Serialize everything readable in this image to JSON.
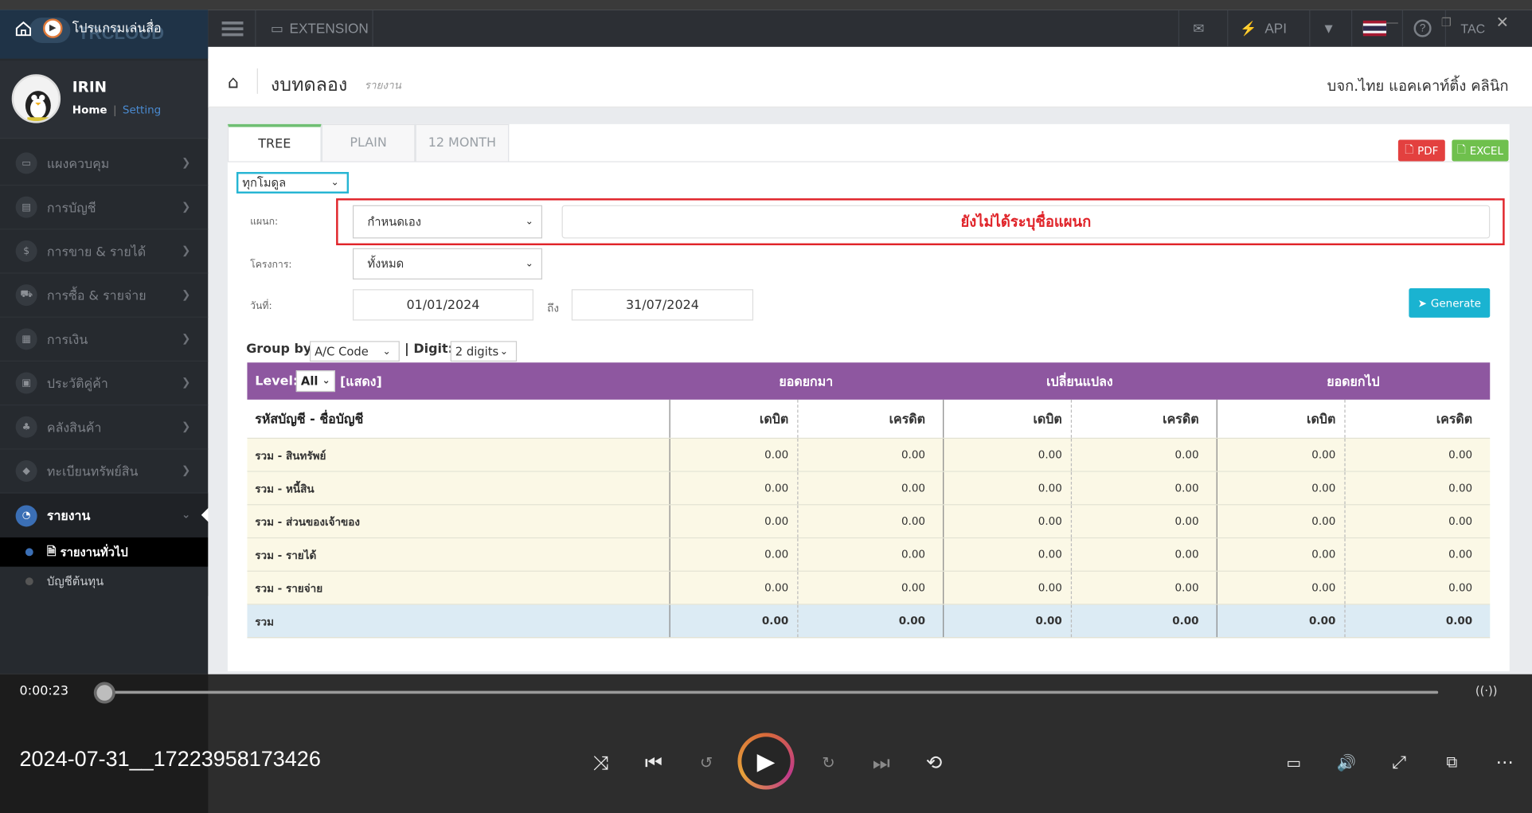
{
  "player": {
    "app_title": "โปรแกรมเล่นสื่อ",
    "time": "0:00:23",
    "filename": "2024-07-31__17223958173426"
  },
  "header": {
    "brand": "TRCLOUD",
    "extension_label": "EXTENSION",
    "api_label": "API",
    "user_code": "TAC"
  },
  "profile": {
    "name": "IRIN",
    "home_link": "Home",
    "setting_link": "Setting"
  },
  "sidebar": {
    "items": [
      {
        "label": "แผงควบคุม",
        "icon": "monitor-icon"
      },
      {
        "label": "การบัญชี",
        "icon": "book-icon"
      },
      {
        "label": "การขาย & รายได้",
        "icon": "dollar-icon"
      },
      {
        "label": "การซื้อ & รายจ่าย",
        "icon": "cart-icon"
      },
      {
        "label": "การเงิน",
        "icon": "calendar-icon"
      },
      {
        "label": "ประวัติคู่ค้า",
        "icon": "contacts-icon"
      },
      {
        "label": "คลังสินค้า",
        "icon": "boxes-icon"
      },
      {
        "label": "ทะเบียนทรัพย์สิน",
        "icon": "diamond-icon"
      },
      {
        "label": "รายงาน",
        "icon": "report-icon"
      }
    ],
    "subitems": [
      {
        "label": "รายงานทั่วไป"
      },
      {
        "label": "บัญชีต้นทุน"
      }
    ]
  },
  "page": {
    "title": "งบทดลอง",
    "subtitle": "รายงาน",
    "company": "บจก.ไทย แอคเคาท์ติ้ง คลินิก"
  },
  "tabs": [
    "TREE",
    "PLAIN",
    "12 MONTH"
  ],
  "export": {
    "pdf": "PDF",
    "excel": "EXCEL"
  },
  "filters": {
    "module_select": "ทุกโมดูล",
    "dept_label": "แผนก:",
    "dept_select": "กำหนดเอง",
    "dept_warning": "ยังไม่ได้ระบุชื่อแผนก",
    "project_label": "โครงการ:",
    "project_select": "ทั้งหมด",
    "date_label": "วันที่:",
    "date_from": "01/01/2024",
    "date_to_label": "ถึง",
    "date_to": "31/07/2024",
    "generate": "Generate",
    "group_by_label": "Group by",
    "group_by_value": "A/C Code",
    "digit_label": "| Digit:",
    "digit_value": "2 digits"
  },
  "table": {
    "level_label": "Level:",
    "level_value": "All",
    "show_label": "[แสดง]",
    "groups": [
      "ยอดยกมา",
      "เปลี่ยนแปลง",
      "ยอดยกไป"
    ],
    "account_header": "รหัสบัญชี - ชื่อบัญชี",
    "subheaders": [
      "เดบิต",
      "เครดิต",
      "เดบิต",
      "เครดิต",
      "เดบิต",
      "เครดิต"
    ],
    "rows": [
      {
        "name": "รวม - สินทรัพย์",
        "values": [
          "0.00",
          "0.00",
          "0.00",
          "0.00",
          "0.00",
          "0.00"
        ]
      },
      {
        "name": "รวม - หนี้สิน",
        "values": [
          "0.00",
          "0.00",
          "0.00",
          "0.00",
          "0.00",
          "0.00"
        ]
      },
      {
        "name": "รวม - ส่วนของเจ้าของ",
        "values": [
          "0.00",
          "0.00",
          "0.00",
          "0.00",
          "0.00",
          "0.00"
        ]
      },
      {
        "name": "รวม - รายได้",
        "values": [
          "0.00",
          "0.00",
          "0.00",
          "0.00",
          "0.00",
          "0.00"
        ]
      },
      {
        "name": "รวม - รายจ่าย",
        "values": [
          "0.00",
          "0.00",
          "0.00",
          "0.00",
          "0.00",
          "0.00"
        ]
      }
    ],
    "total_row": {
      "name": "รวม",
      "values": [
        "0.00",
        "0.00",
        "0.00",
        "0.00",
        "0.00",
        "0.00"
      ]
    }
  },
  "colors": {
    "table_header": "#8e57a0",
    "warning_border": "#e0242a",
    "warning_text": "#e0242a",
    "generate": "#1ab3d1",
    "pdf": "#e3403f",
    "excel": "#6fc04d"
  }
}
